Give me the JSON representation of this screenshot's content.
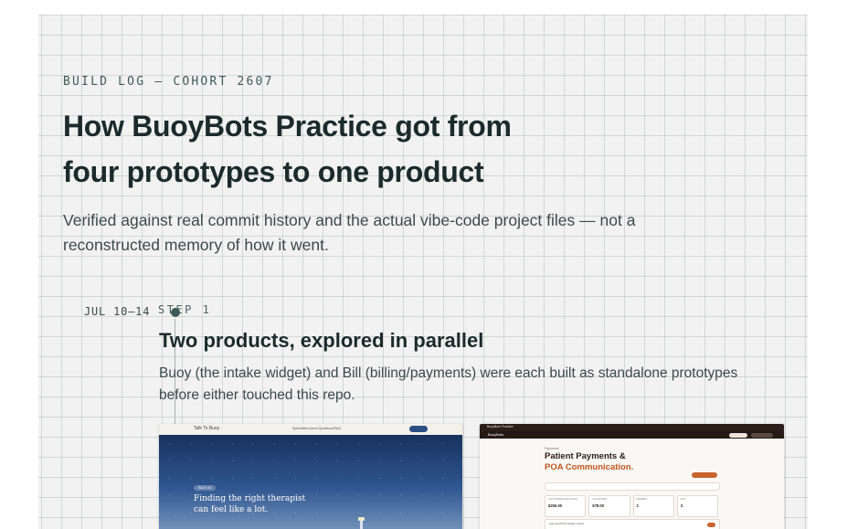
{
  "header": {
    "eyebrow": "BUILD LOG — COHORT 2607",
    "title_line1": "How BuoyBots Practice got from",
    "title_line2": "four prototypes to one product",
    "lede": "Verified against real commit history and the actual vibe-code project files — not a reconstructed memory of how it went."
  },
  "timeline": {
    "steps": [
      {
        "date": "JUL 10–14",
        "label": "STEP 1",
        "title": "Two products, explored in parallel",
        "description": "Buoy (the intake widget) and Bill (billing/payments) were each built as standalone prototypes before either touched this repo."
      }
    ]
  },
  "screenshots": {
    "buoy": {
      "logo": "Talk To Buoy",
      "nav_links": "Specialties   About   Questions/FAQ",
      "tag": "BUOY AI",
      "headline": "Finding the right therapist can feel like a lot."
    },
    "bill": {
      "nav_text": "BuoyBots Practice",
      "logo": "BuoyBots",
      "kicker": "Payments",
      "title_line1": "Patient Payments &",
      "title_line2": "POA Communication.",
      "cards": [
        {
          "label": "OUTSTANDING BALANCE",
          "value": "$206.00"
        },
        {
          "label": "COLLECTED",
          "value": "$78.00"
        },
        {
          "label": "PENDING",
          "value": "2"
        },
        {
          "label": "POA",
          "value": "3"
        }
      ],
      "row_text": "Auto-send POA update notices"
    }
  }
}
